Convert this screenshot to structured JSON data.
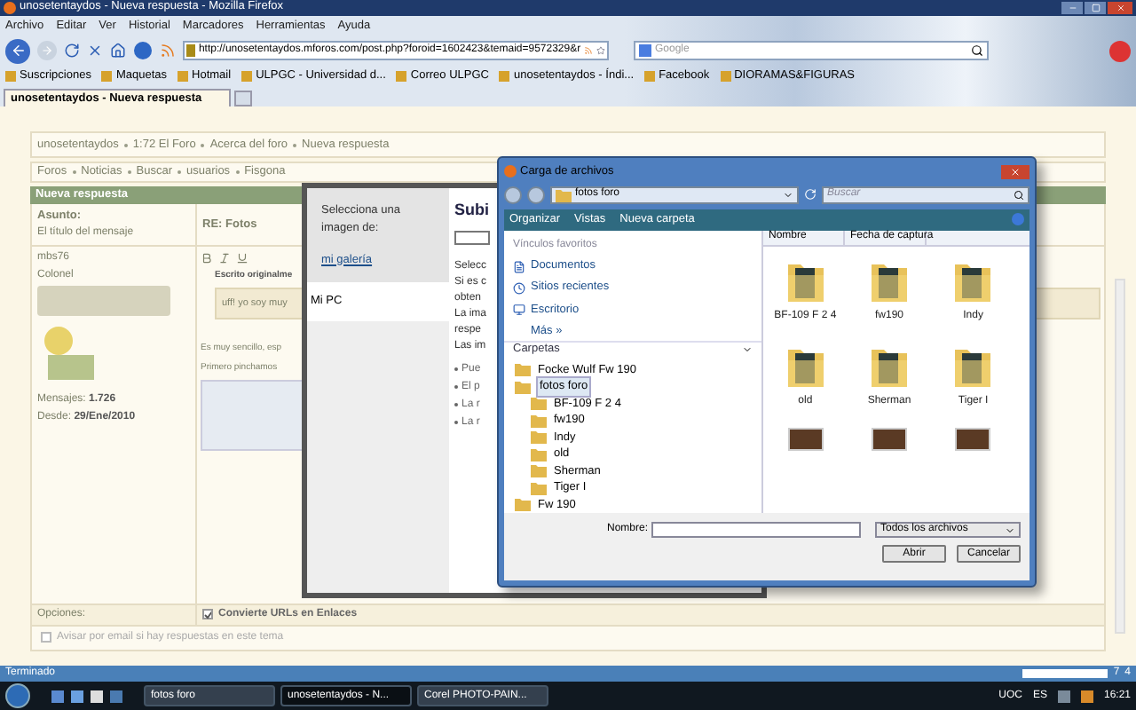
{
  "browser": {
    "title": "unosetentaydos - Nueva respuesta - Mozilla Firefox",
    "menu": [
      "Archivo",
      "Editar",
      "Ver",
      "Historial",
      "Marcadores",
      "Herramientas",
      "Ayuda"
    ],
    "url": "http://unosetentaydos.mforos.com/post.php?foroid=1602423&temaid=9572329&r",
    "search_placeholder": "Google",
    "bookmarks": [
      "Suscripciones",
      "Maquetas",
      "Hotmail",
      "ULPGC - Universidad d...",
      "Correo ULPGC",
      "unosetentaydos - Índi...",
      "Facebook",
      "DIORAMAS&FIGURAS"
    ],
    "tabs": [
      {
        "label": "unosetentaydos - Nueva respuesta",
        "selected": true
      }
    ],
    "status": "Terminado",
    "status_counts": [
      "7",
      "4"
    ]
  },
  "forum": {
    "breadcrumb": [
      "unosetentaydos",
      "1:72 El Foro",
      "Acerca del foro",
      "Nueva respuesta"
    ],
    "nav": [
      "Foros",
      "Noticias",
      "Buscar",
      "usuarios",
      "Fisgona"
    ],
    "header": "Nueva respuesta",
    "subject_label": "Asunto:",
    "subject_hint": "El título del mensaje",
    "subject_value": "RE: Fotos",
    "user": {
      "name": "mbs76",
      "rank": "Colonel",
      "messages_label": "Mensajes:",
      "messages": "1.726",
      "since_label": "Desde:",
      "since": "29/Ene/2010"
    },
    "quote_heading": "Escrito originalme",
    "quote_text": "uff! yo soy muy",
    "body": [
      "Es muy sencillo, esp",
      "Primero pinchamos"
    ],
    "options_label": "Opciones:",
    "options": [
      {
        "label": "Convierte URLs en Enlaces",
        "checked": true
      },
      {
        "label": "Avisar por email si hay respuestas en este tema",
        "checked": false
      }
    ]
  },
  "upload": {
    "sidebar_title": "Selecciona una imagen de:",
    "sources": [
      {
        "label": "mi galería",
        "selected": false
      },
      {
        "label": "Mi PC",
        "selected": true
      }
    ],
    "heading": "Subi",
    "lines": [
      "Selecc",
      "Si es c",
      "obten",
      "La ima",
      "respe",
      "Las im"
    ],
    "bullets": [
      "Pue",
      "El p",
      "La r",
      "La r"
    ]
  },
  "dialog": {
    "title": "Carga de archivos",
    "path": "fotos foro",
    "search_placeholder": "Buscar",
    "toolbar": [
      "Organizar",
      "Vistas",
      "Nueva carpeta"
    ],
    "favorites_title": "Vínculos favoritos",
    "favorites": [
      "Documentos",
      "Sitios recientes",
      "Escritorio"
    ],
    "more": "Más »",
    "folders_title": "Carpetas",
    "tree": [
      {
        "label": "Focke Wulf Fw 190"
      },
      {
        "label": "fotos foro",
        "selected": true,
        "children": [
          {
            "label": "BF-109 F 2 4"
          },
          {
            "label": "fw190"
          },
          {
            "label": "Indy"
          },
          {
            "label": "old"
          },
          {
            "label": "Sherman"
          },
          {
            "label": "Tiger I"
          }
        ]
      },
      {
        "label": "Fw 190"
      }
    ],
    "columns": [
      "Nombre",
      "Fecha de captura"
    ],
    "items": [
      {
        "kind": "folder",
        "name": "BF-109 F 2 4"
      },
      {
        "kind": "folder",
        "name": "fw190"
      },
      {
        "kind": "folder",
        "name": "Indy"
      },
      {
        "kind": "folder",
        "name": "old"
      },
      {
        "kind": "folder",
        "name": "Sherman"
      },
      {
        "kind": "folder",
        "name": "Tiger I"
      },
      {
        "kind": "photo"
      },
      {
        "kind": "photo"
      },
      {
        "kind": "photo"
      }
    ],
    "filename_label": "Nombre:",
    "filetype": "Todos los archivos",
    "buttons": [
      "Abrir",
      "Cancelar"
    ]
  },
  "taskbar": {
    "items": [
      {
        "label": "fotos foro",
        "selected": false
      },
      {
        "label": "unosetentaydos - N...",
        "selected": true
      },
      {
        "label": "Corel PHOTO-PAIN...",
        "selected": false
      }
    ],
    "tray": [
      "UOC",
      "ES"
    ],
    "clock": "16:21"
  }
}
